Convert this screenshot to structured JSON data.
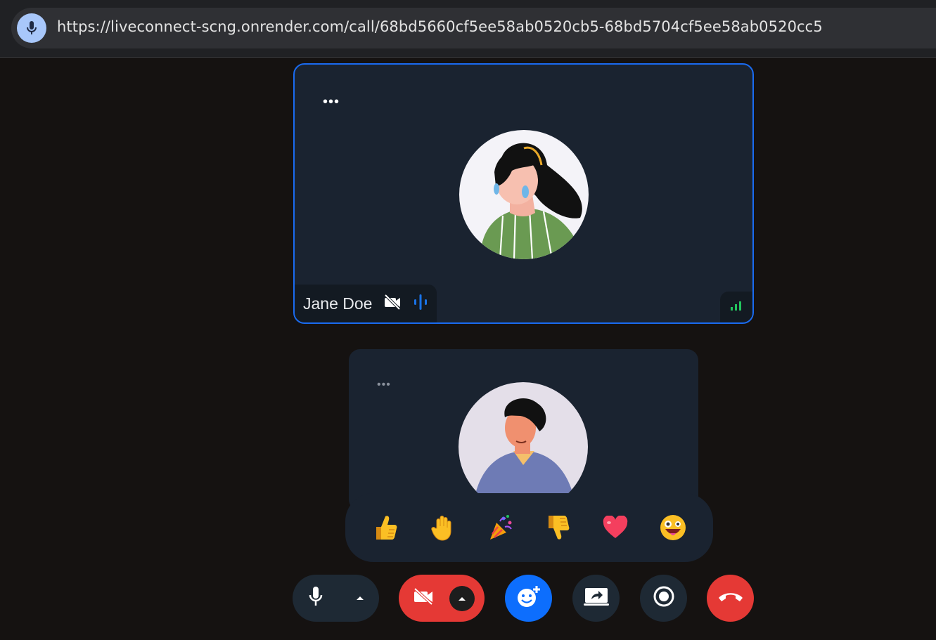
{
  "browser": {
    "url": "https://liveconnect-scng.onrender.com/call/68bd5660cf5ee58ab0520cb5-68bd5704cf5ee58ab0520cc5",
    "mic_indicator_icon": "microphone-icon"
  },
  "tiles": [
    {
      "participant_name": "Jane Doe",
      "active_speaker": true,
      "camera": "off",
      "mic": "speaking",
      "network": "good"
    },
    {
      "participant_name": "",
      "active_speaker": false
    }
  ],
  "more_label": "•••",
  "reactions": [
    {
      "name": "thumbs-up",
      "glyph": "👍"
    },
    {
      "name": "raised-hand",
      "glyph": "✋"
    },
    {
      "name": "party-popper",
      "glyph": "🎉"
    },
    {
      "name": "thumbs-down",
      "glyph": "👎"
    },
    {
      "name": "heart",
      "glyph": "❤"
    },
    {
      "name": "grinning-face",
      "glyph": "😜"
    }
  ],
  "controls": [
    {
      "name": "microphone",
      "state": "on",
      "icon": "microphone-icon"
    },
    {
      "name": "camera",
      "state": "off",
      "icon": "camera-off-icon"
    },
    {
      "name": "reactions",
      "icon": "emoji-add-icon"
    },
    {
      "name": "screen-share",
      "icon": "screen-share-icon"
    },
    {
      "name": "record",
      "icon": "record-icon"
    },
    {
      "name": "end-call",
      "icon": "phone-hangup-icon"
    }
  ],
  "colors": {
    "active_border": "#1a6bf0",
    "danger": "#e53935",
    "primary": "#0d6efd",
    "tile_bg": "#1a2330",
    "page_bg": "#151211"
  }
}
